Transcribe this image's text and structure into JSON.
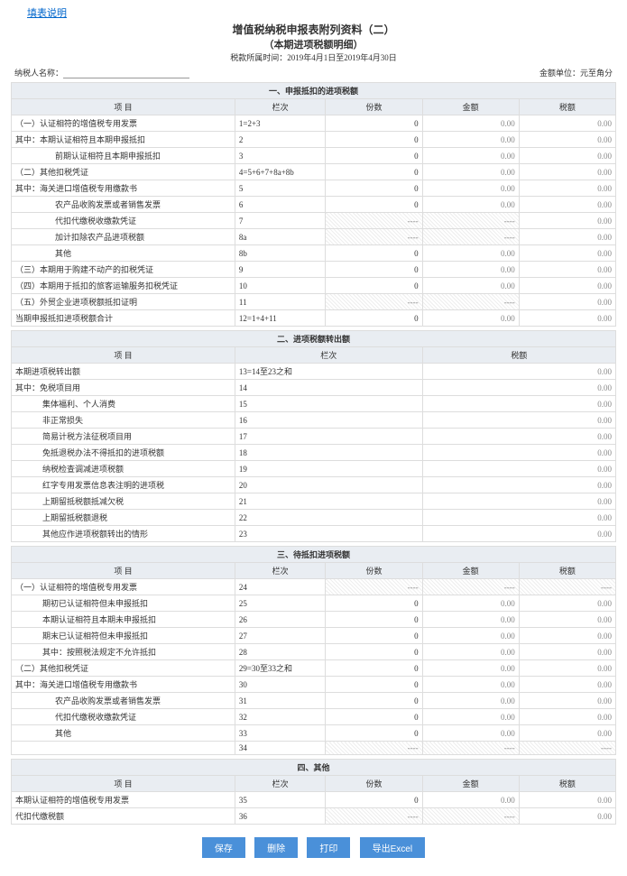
{
  "help_link": "填表说明",
  "title": "增值税纳税申报表附列资料（二）",
  "subtitle": "（本期进项税额明细）",
  "period_label": "税款所属时间：2019年4月1日至2019年4月30日",
  "taxpayer_label": "纳税人名称：",
  "unit_label": "金额单位：元至角分",
  "cols": {
    "item": "项    目",
    "lc": "栏次",
    "fen": "份数",
    "jine": "金额",
    "shuie": "税额"
  },
  "sections": {
    "s1": "一、申报抵扣的进项税额",
    "s2": "二、进项税额转出额",
    "s3": "三、待抵扣进项税额",
    "s4": "四、其他"
  },
  "rows_s1": [
    {
      "name": "（一）认证相符的增值税专用发票",
      "lc": "1=2+3",
      "fen": "0",
      "jine": "0.00",
      "shuie": "0.00",
      "cls": ""
    },
    {
      "name": "其中：本期认证相符且本期申报抵扣",
      "lc": "2",
      "fen": "0",
      "jine": "0.00",
      "shuie": "0.00",
      "cls": ""
    },
    {
      "name": "前期认证相符且本期申报抵扣",
      "lc": "3",
      "fen": "0",
      "jine": "0.00",
      "shuie": "0.00",
      "cls": "indent2"
    },
    {
      "name": "（二）其他扣税凭证",
      "lc": "4=5+6+7+8a+8b",
      "fen": "0",
      "jine": "0.00",
      "shuie": "0.00",
      "cls": ""
    },
    {
      "name": "其中：海关进口增值税专用缴款书",
      "lc": "5",
      "fen": "0",
      "jine": "0.00",
      "shuie": "0.00",
      "cls": ""
    },
    {
      "name": "农产品收购发票或者销售发票",
      "lc": "6",
      "fen": "0",
      "jine": "0.00",
      "shuie": "0.00",
      "cls": "indent2"
    },
    {
      "name": "代扣代缴税收缴款凭证",
      "lc": "7",
      "fen": "----",
      "jine": "----",
      "shuie": "0.00",
      "cls": "indent2",
      "hatch": [
        "fen",
        "jine"
      ]
    },
    {
      "name": "加计扣除农产品进项税额",
      "lc": "8a",
      "fen": "----",
      "jine": "----",
      "shuie": "0.00",
      "cls": "indent2",
      "hatch": [
        "fen",
        "jine"
      ]
    },
    {
      "name": "其他",
      "lc": "8b",
      "fen": "0",
      "jine": "0.00",
      "shuie": "0.00",
      "cls": "indent2"
    },
    {
      "name": "（三）本期用于购建不动产的扣税凭证",
      "lc": "9",
      "fen": "0",
      "jine": "0.00",
      "shuie": "0.00",
      "cls": ""
    },
    {
      "name": "（四）本期用于抵扣的旅客运输服务扣税凭证",
      "lc": "10",
      "fen": "0",
      "jine": "0.00",
      "shuie": "0.00",
      "cls": ""
    },
    {
      "name": "（五）外贸企业进项税额抵扣证明",
      "lc": "11",
      "fen": "----",
      "jine": "----",
      "shuie": "0.00",
      "cls": "",
      "hatch": [
        "fen",
        "jine"
      ]
    },
    {
      "name": "当期申报抵扣进项税额合计",
      "lc": "12=1+4+11",
      "fen": "0",
      "jine": "0.00",
      "shuie": "0.00",
      "cls": ""
    }
  ],
  "rows_s2": [
    {
      "name": "本期进项税转出额",
      "lc": "13=14至23之和",
      "shuie": "0.00",
      "cls": ""
    },
    {
      "name": "其中：免税项目用",
      "lc": "14",
      "shuie": "0.00",
      "cls": ""
    },
    {
      "name": "集体福利、个人消费",
      "lc": "15",
      "shuie": "0.00",
      "cls": "indent1"
    },
    {
      "name": "非正常损失",
      "lc": "16",
      "shuie": "0.00",
      "cls": "indent1"
    },
    {
      "name": "简易计税方法征税项目用",
      "lc": "17",
      "shuie": "0.00",
      "cls": "indent1"
    },
    {
      "name": "免抵退税办法不得抵扣的进项税额",
      "lc": "18",
      "shuie": "0.00",
      "cls": "indent1"
    },
    {
      "name": "纳税检查调减进项税额",
      "lc": "19",
      "shuie": "0.00",
      "cls": "indent1"
    },
    {
      "name": "红字专用发票信息表注明的进项税",
      "lc": "20",
      "shuie": "0.00",
      "cls": "indent1"
    },
    {
      "name": "上期留抵税额抵减欠税",
      "lc": "21",
      "shuie": "0.00",
      "cls": "indent1"
    },
    {
      "name": "上期留抵税额退税",
      "lc": "22",
      "shuie": "0.00",
      "cls": "indent1"
    },
    {
      "name": "其他应作进项税额转出的情形",
      "lc": "23",
      "shuie": "0.00",
      "cls": "indent1"
    }
  ],
  "rows_s3": [
    {
      "name": "（一）认证相符的增值税专用发票",
      "lc": "24",
      "fen": "----",
      "jine": "----",
      "shuie": "----",
      "cls": "",
      "hatch": [
        "fen",
        "jine",
        "shuie"
      ]
    },
    {
      "name": "期初已认证相符但未申报抵扣",
      "lc": "25",
      "fen": "0",
      "jine": "0.00",
      "shuie": "0.00",
      "cls": "indent1"
    },
    {
      "name": "本期认证相符且本期未申报抵扣",
      "lc": "26",
      "fen": "0",
      "jine": "0.00",
      "shuie": "0.00",
      "cls": "indent1"
    },
    {
      "name": "期末已认证相符但未申报抵扣",
      "lc": "27",
      "fen": "0",
      "jine": "0.00",
      "shuie": "0.00",
      "cls": "indent1"
    },
    {
      "name": "其中：按照税法规定不允许抵扣",
      "lc": "28",
      "fen": "0",
      "jine": "0.00",
      "shuie": "0.00",
      "cls": "indent1"
    },
    {
      "name": "（二）其他扣税凭证",
      "lc": "29=30至33之和",
      "fen": "0",
      "jine": "0.00",
      "shuie": "0.00",
      "cls": ""
    },
    {
      "name": "其中：海关进口增值税专用缴款书",
      "lc": "30",
      "fen": "0",
      "jine": "0.00",
      "shuie": "0.00",
      "cls": ""
    },
    {
      "name": "农产品收购发票或者销售发票",
      "lc": "31",
      "fen": "0",
      "jine": "0.00",
      "shuie": "0.00",
      "cls": "indent2"
    },
    {
      "name": "代扣代缴税收缴款凭证",
      "lc": "32",
      "fen": "0",
      "jine": "0.00",
      "shuie": "0.00",
      "cls": "indent2"
    },
    {
      "name": "其他",
      "lc": "33",
      "fen": "0",
      "jine": "0.00",
      "shuie": "0.00",
      "cls": "indent2"
    },
    {
      "name": "",
      "lc": "34",
      "fen": "----",
      "jine": "----",
      "shuie": "----",
      "cls": "",
      "hatch": [
        "fen",
        "jine",
        "shuie"
      ]
    }
  ],
  "rows_s4": [
    {
      "name": "本期认证相符的增值税专用发票",
      "lc": "35",
      "fen": "0",
      "jine": "0.00",
      "shuie": "0.00",
      "cls": ""
    },
    {
      "name": "代扣代缴税额",
      "lc": "36",
      "fen": "----",
      "jine": "----",
      "shuie": "0.00",
      "cls": "",
      "hatch": [
        "fen",
        "jine"
      ]
    }
  ],
  "buttons": {
    "save": "保存",
    "delete": "删除",
    "print": "打印",
    "export": "导出Excel"
  }
}
